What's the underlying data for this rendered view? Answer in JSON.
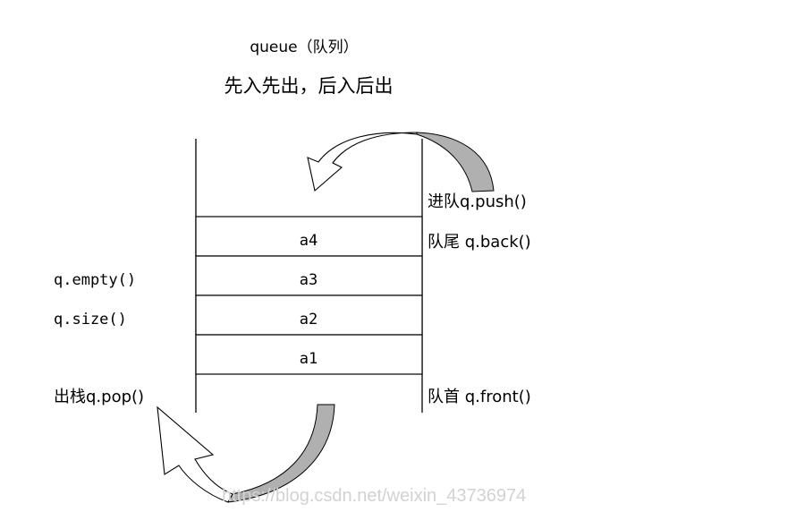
{
  "title": "queue（队列）",
  "subtitle": "先入先出，后入后出",
  "queue": {
    "cells": [
      "a4",
      "a3",
      "a2",
      "a1"
    ]
  },
  "labels": {
    "push": "进队q.push()",
    "back": "队尾 q.back()",
    "front": "队首 q.front()",
    "empty": "q.empty()",
    "size": "q.size()",
    "pop": "出栈q.pop()"
  },
  "watermark": "https://blog.csdn.net/weixin_43736974",
  "colors": {
    "line": "#000000",
    "arrow_fill_light": "#ffffff",
    "arrow_fill_shade": "#b0b0b0",
    "watermark": "#d2d2d2"
  }
}
